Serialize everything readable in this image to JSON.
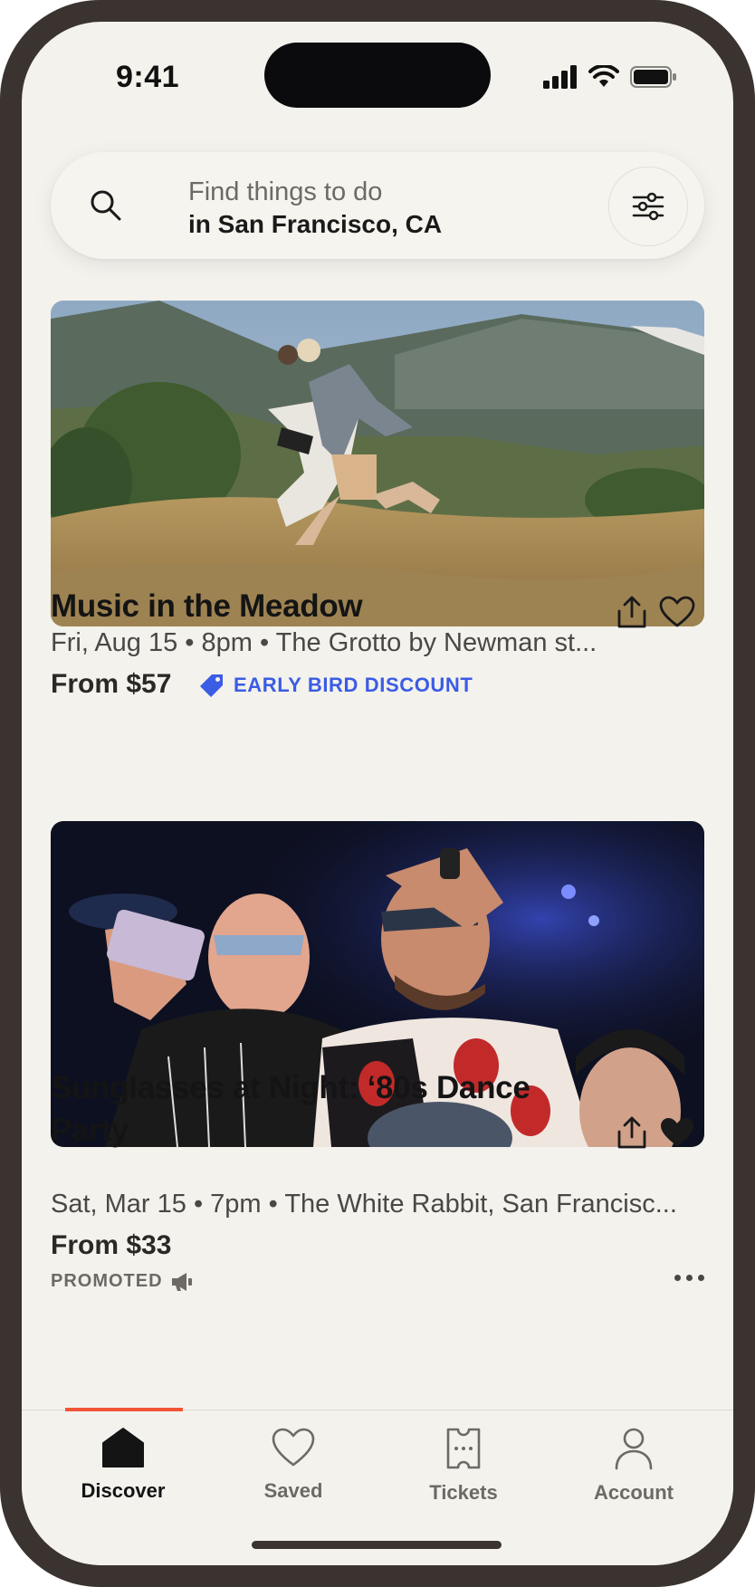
{
  "status_bar": {
    "time": "9:41"
  },
  "search": {
    "placeholder": "Find things to do",
    "location": "in San Francisco, CA"
  },
  "events": [
    {
      "title": "Music in the Meadow",
      "meta": "Fri, Aug 15 • 8pm • The Grotto by Newman st...",
      "price": "From $57",
      "badge": "EARLY BIRD DISCOUNT",
      "saved": false
    },
    {
      "title": "Sunglasses at Night: ‘80s Dance Party",
      "meta": "Sat, Mar 15 • 7pm • The White Rabbit, San Francisc...",
      "price": "From $33",
      "promoted": "PROMOTED",
      "saved": true
    }
  ],
  "tabs": [
    {
      "label": "Discover",
      "icon": "home-icon",
      "active": true
    },
    {
      "label": "Saved",
      "icon": "heart-icon",
      "active": false
    },
    {
      "label": "Tickets",
      "icon": "ticket-icon",
      "active": false
    },
    {
      "label": "Account",
      "icon": "person-icon",
      "active": false
    }
  ],
  "colors": {
    "accent_orange": "#f05537",
    "discount_blue": "#3b5ce4",
    "background": "#f3f2ed"
  }
}
